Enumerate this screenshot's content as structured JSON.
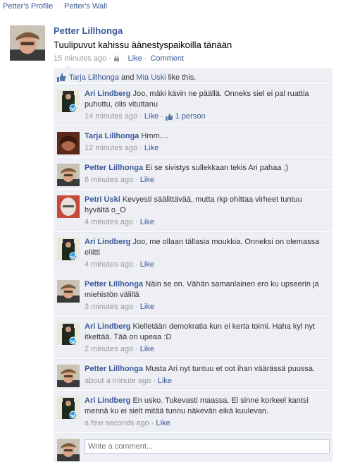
{
  "breadcrumbs": {
    "profile": "Petter's Profile",
    "sep": "·",
    "wall": "Petter's Wall"
  },
  "post": {
    "author": "Petter Lillhonga",
    "text": "Tuulipuvut kahissu äänestyspaikoilla tänään",
    "time": "15 minutes ago",
    "sep": "·",
    "like": "Like",
    "comment": "Comment"
  },
  "likes": {
    "person1": "Tarja Lillhonga",
    "and": "and",
    "person2": "Mia Uski",
    "suffix": "like this."
  },
  "comments": [
    {
      "name": "Ari Lindberg",
      "text": "Joo, mäki kävin ne päällä. Onneks siel ei pal ruattia puhuttu, olis vituttanu",
      "time": "14 minutes ago",
      "like": "Like",
      "likes": "1 person",
      "avatar": "ari"
    },
    {
      "name": "Tarja Lillhonga",
      "text": "Hmm....",
      "time": "12 minutes ago",
      "like": "Like",
      "avatar": "tarja"
    },
    {
      "name": "Petter Lillhonga",
      "text": "Ei se sivistys sullekkaan tekis Ari pahaa ;)",
      "time": "6 minutes ago",
      "like": "Like",
      "avatar": "petter"
    },
    {
      "name": "Petri Uski",
      "text": "Kevyesti säälittävää, mutta rkp ohittaa virheet tuntuu hyvältä o_O",
      "time": "4 minutes ago",
      "like": "Like",
      "avatar": "petri"
    },
    {
      "name": "Ari Lindberg",
      "text": "Joo, me ollaan tällasia moukkia. Onneksi on olemassa eliitti",
      "time": "4 minutes ago",
      "like": "Like",
      "avatar": "ari"
    },
    {
      "name": "Petter Lillhonga",
      "text": "Näin se on. Vähän samanlainen ero ku upseerin ja miehistön välillä",
      "time": "3 minutes ago",
      "like": "Like",
      "avatar": "petter"
    },
    {
      "name": "Ari Lindberg",
      "text": "Kielletään demokratia kun ei kerta toimi. Haha kyl nyt itkettää. Tää on upeaa :D",
      "time": "2 minutes ago",
      "like": "Like",
      "avatar": "ari"
    },
    {
      "name": "Petter Lillhonga",
      "text": "Musta Ari nyt tuntuu et oot ihan väärässä puussa.",
      "time": "about a minute ago",
      "like": "Like",
      "avatar": "petter"
    },
    {
      "name": "Ari Lindberg",
      "text": "En usko. Tukevasti maassa. Ei sinne korkeel kantsi mennä ku ei sielt mitää tunnu näkevän eikä kuulevan.",
      "time": "a few seconds ago",
      "like": "Like",
      "avatar": "ari"
    }
  ],
  "composer": {
    "placeholder": "Write a comment..."
  },
  "colors": {
    "link": "#3b5998",
    "panel": "#edeff4",
    "meta": "#999999"
  }
}
